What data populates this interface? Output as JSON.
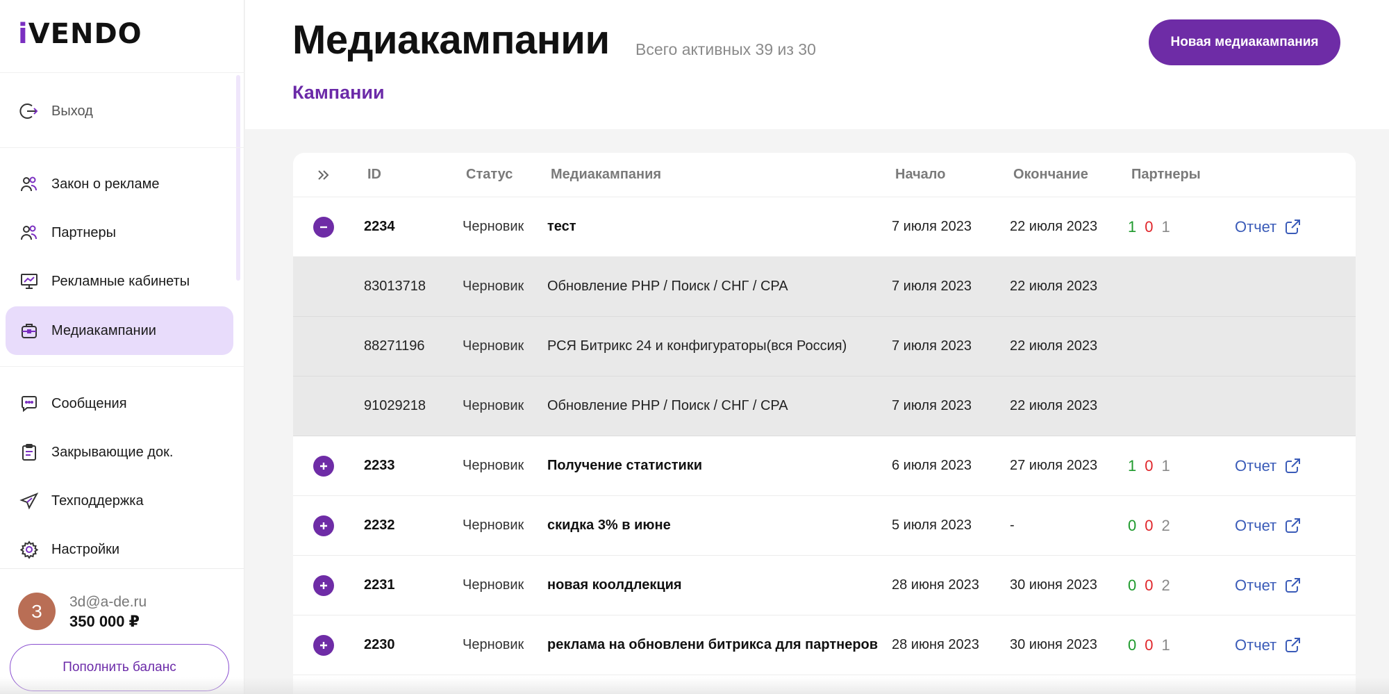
{
  "brand": {
    "logo_text": "iVENDO",
    "accent": "#6e2ca6"
  },
  "sidebar": {
    "logout_label": "Выход",
    "items": [
      {
        "label": "Закон о рекламе",
        "icon": "users-icon"
      },
      {
        "label": "Партнеры",
        "icon": "users-icon"
      },
      {
        "label": "Рекламные кабинеты",
        "icon": "presentation-chart-icon"
      },
      {
        "label": "Медиакампании",
        "icon": "briefcase-icon",
        "active": true
      },
      {
        "label": "Сообщения",
        "icon": "chat-icon"
      },
      {
        "label": "Закрывающие док.",
        "icon": "clipboard-icon"
      },
      {
        "label": "Техподдержка",
        "icon": "send-icon"
      },
      {
        "label": "Настройки",
        "icon": "gear-icon"
      }
    ],
    "user": {
      "avatar_letter": "З",
      "email": "3d@a-de.ru",
      "balance": "350 000 ₽"
    },
    "topup_label": "Пополнить баланс"
  },
  "header": {
    "title": "Медиакампании",
    "subtitle": "Всего активных 39 из 30",
    "new_button": "Новая медиакампания",
    "tab": "Кампании"
  },
  "table": {
    "columns": {
      "id": "ID",
      "status": "Статус",
      "name": "Медиакампания",
      "start": "Начало",
      "end": "Окончание",
      "partners": "Партнеры"
    },
    "rows": [
      {
        "id": "2234",
        "status": "Черновик",
        "name": "тест",
        "start": "7 июля 2023",
        "end": "22 июля 2023",
        "p_green": "1",
        "p_red": "0",
        "p_gray": "1",
        "report": "Отчет",
        "expanded": true,
        "children": [
          {
            "id": "83013718",
            "status": "Черновик",
            "name": "Обновление PHP / Поиск / СНГ / CPA",
            "start": "7 июля 2023",
            "end": "22 июля 2023"
          },
          {
            "id": "88271196",
            "status": "Черновик",
            "name": "РСЯ Битрикс 24 и конфигураторы(вся Россия)",
            "start": "7 июля 2023",
            "end": "22 июля 2023"
          },
          {
            "id": "91029218",
            "status": "Черновик",
            "name": "Обновление PHP / Поиск / СНГ / CPA",
            "start": "7 июля 2023",
            "end": "22 июля 2023"
          }
        ]
      },
      {
        "id": "2233",
        "status": "Черновик",
        "name": "Получение статистики",
        "start": "6 июля 2023",
        "end": "27 июля 2023",
        "p_green": "1",
        "p_red": "0",
        "p_gray": "1",
        "report": "Отчет"
      },
      {
        "id": "2232",
        "status": "Черновик",
        "name": "скидка 3% в июне",
        "start": "5 июля 2023",
        "end": "-",
        "p_green": "0",
        "p_red": "0",
        "p_gray": "2",
        "report": "Отчет"
      },
      {
        "id": "2231",
        "status": "Черновик",
        "name": "новая коолдлекция",
        "start": "28 июня 2023",
        "end": "30 июня 2023",
        "p_green": "0",
        "p_red": "0",
        "p_gray": "2",
        "report": "Отчет"
      },
      {
        "id": "2230",
        "status": "Черновик",
        "name": "реклама на обновлени битрикса для партнеров",
        "start": "28 июня 2023",
        "end": "30 июня 2023",
        "p_green": "0",
        "p_red": "0",
        "p_gray": "1",
        "report": "Отчет"
      }
    ]
  }
}
